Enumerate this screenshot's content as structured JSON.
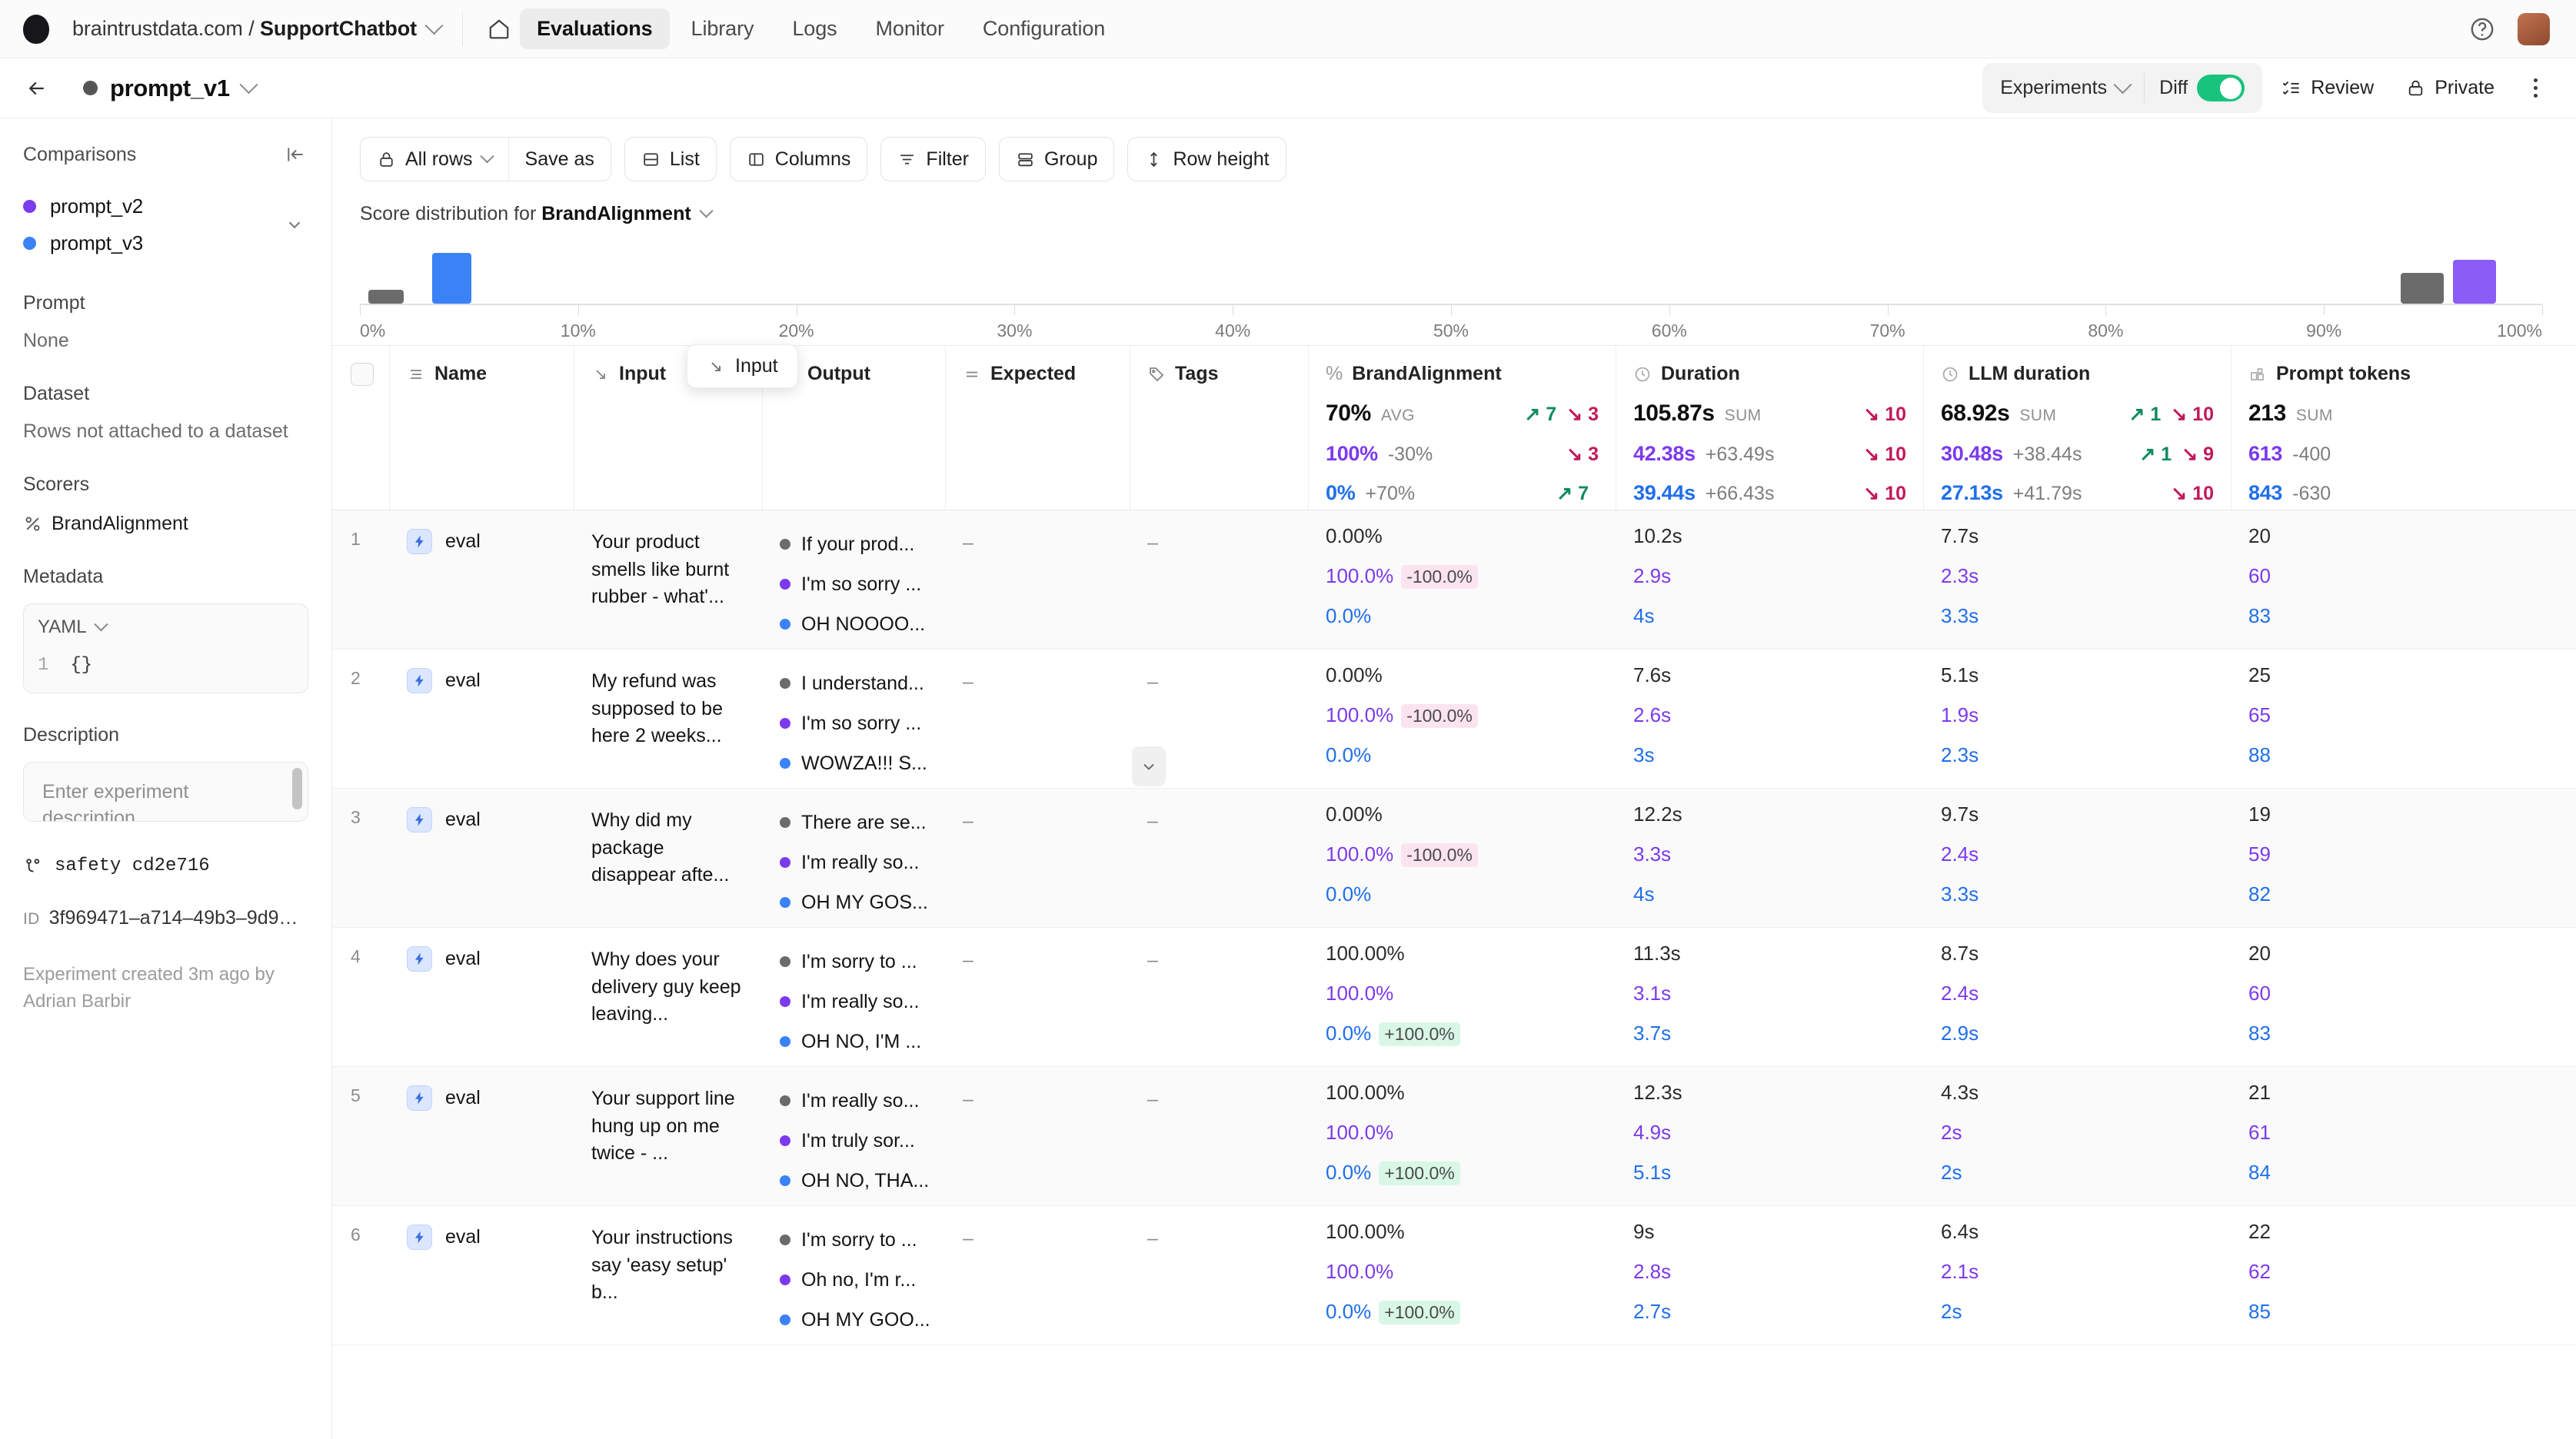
{
  "topbar": {
    "org_prefix": "braintrustdata.com / ",
    "org_project": "SupportChatbot",
    "nav": [
      {
        "label": "Evaluations",
        "active": true
      },
      {
        "label": "Library",
        "active": false
      },
      {
        "label": "Logs",
        "active": false
      },
      {
        "label": "Monitor",
        "active": false
      },
      {
        "label": "Configuration",
        "active": false
      }
    ],
    "home_icon": "home-icon",
    "help_icon": "help-circle-icon",
    "avatar": "user-avatar"
  },
  "subheader": {
    "back_icon": "back-arrow-icon",
    "experiment_name": "prompt_v1",
    "experiments_label": "Experiments",
    "diff_label": "Diff",
    "diff_on": true,
    "review_label": "Review",
    "private_label": "Private",
    "more_icon": "kebab-menu-icon"
  },
  "sidebar": {
    "comparisons_title": "Comparisons",
    "comparisons": [
      {
        "label": "prompt_v2",
        "color": "#7c3aed"
      },
      {
        "label": "prompt_v3",
        "color": "#3b82f6"
      }
    ],
    "prompt_label": "Prompt",
    "prompt_value": "None",
    "dataset_label": "Dataset",
    "dataset_value": "Rows not attached to a dataset",
    "scorers_label": "Scorers",
    "scorer_name": "BrandAlignment",
    "metadata_label": "Metadata",
    "metadata_lang": "YAML",
    "metadata_gutter": "1",
    "metadata_value": "{}",
    "description_label": "Description",
    "description_placeholder": "Enter experiment description...",
    "branch": "safety cd2e716",
    "id_tag": "ID",
    "id_value": "3f969471–a714–49b3–9d9…",
    "created": "Experiment created 3m ago by Adrian Barbir"
  },
  "toolbar": {
    "all_rows": "All rows",
    "save_as": "Save as",
    "list": "List",
    "columns": "Columns",
    "filter": "Filter",
    "group": "Group",
    "row_height": "Row height"
  },
  "distribution": {
    "title_prefix": "Score distribution for ",
    "title_metric": "BrandAlignment"
  },
  "chart_data": {
    "type": "bar",
    "title": "Score distribution for BrandAlignment",
    "xlabel": "",
    "ylabel": "",
    "xlim": [
      0,
      100
    ],
    "grid": false,
    "legend": "none",
    "tick_labels": [
      "0%",
      "10%",
      "20%",
      "30%",
      "40%",
      "50%",
      "60%",
      "70%",
      "80%",
      "90%",
      "100%"
    ],
    "ticks": [
      0,
      10,
      20,
      30,
      40,
      50,
      60,
      70,
      80,
      90,
      100
    ],
    "bars": [
      {
        "series": "prompt_v1",
        "color": "#6b6b6b",
        "x_pct": 0.4,
        "width_pct": 1.6,
        "height_pct": 22
      },
      {
        "series": "prompt_v3",
        "color": "#3b82f6",
        "x_pct": 3.3,
        "width_pct": 1.8,
        "height_pct": 78
      },
      {
        "series": "prompt_v1",
        "color": "#6b6b6b",
        "x_pct": 93.5,
        "width_pct": 2.0,
        "height_pct": 48
      },
      {
        "series": "prompt_v2",
        "color": "#8b5cf6",
        "x_pct": 95.9,
        "width_pct": 2.0,
        "height_pct": 68
      }
    ]
  },
  "table": {
    "columns": [
      {
        "key": "check",
        "label": "",
        "icon": "checkbox-icon"
      },
      {
        "key": "name",
        "label": "Name",
        "icon": "list-icon"
      },
      {
        "key": "input",
        "label": "Input",
        "icon": "arrow-into-icon"
      },
      {
        "key": "output",
        "label": "Output",
        "icon": "arrow-out-icon"
      },
      {
        "key": "expected",
        "label": "Expected",
        "icon": "equals-icon"
      },
      {
        "key": "tags",
        "label": "Tags",
        "icon": "tag-icon"
      },
      {
        "key": "brand",
        "label": "BrandAlignment",
        "icon": "percent-icon"
      },
      {
        "key": "duration",
        "label": "Duration",
        "icon": "clock-icon"
      },
      {
        "key": "llm",
        "label": "LLM duration",
        "icon": "clock-icon"
      },
      {
        "key": "tokens",
        "label": "Prompt tokens",
        "icon": "blocks-icon"
      }
    ],
    "drag_chip": {
      "label": "Input",
      "icon": "arrow-into-icon"
    },
    "summary": {
      "brand": [
        {
          "value": "70%",
          "agg": "AVG",
          "delta": "",
          "up": "↗ 7",
          "down": "↘ 3",
          "color": "#0d0d0d"
        },
        {
          "value": "100%",
          "agg": "",
          "delta": "-30%",
          "up": "",
          "down": "↘ 3",
          "color": "#7c3aed"
        },
        {
          "value": "0%",
          "agg": "",
          "delta": "+70%",
          "up": "↗ 7",
          "down": "",
          "color": "#1f6feb"
        }
      ],
      "duration": [
        {
          "value": "105.87s",
          "agg": "SUM",
          "delta": "",
          "up": "",
          "down": "↘ 10",
          "color": "#0d0d0d"
        },
        {
          "value": "42.38s",
          "agg": "",
          "delta": "+63.49s",
          "up": "",
          "down": "↘ 10",
          "color": "#7c3aed"
        },
        {
          "value": "39.44s",
          "agg": "",
          "delta": "+66.43s",
          "up": "",
          "down": "↘ 10",
          "color": "#1f6feb"
        }
      ],
      "llm": [
        {
          "value": "68.92s",
          "agg": "SUM",
          "delta": "",
          "up": "↗ 1",
          "down": "↘ 10",
          "color": "#0d0d0d"
        },
        {
          "value": "30.48s",
          "agg": "",
          "delta": "+38.44s",
          "up": "↗ 1",
          "down": "↘ 9",
          "color": "#7c3aed"
        },
        {
          "value": "27.13s",
          "agg": "",
          "delta": "+41.79s",
          "up": "",
          "down": "↘ 10",
          "color": "#1f6feb"
        }
      ],
      "tokens": [
        {
          "value": "213",
          "agg": "SUM",
          "delta": "",
          "up": "",
          "down": "",
          "color": "#0d0d0d"
        },
        {
          "value": "613",
          "agg": "",
          "delta": "-400",
          "up": "",
          "down": "",
          "color": "#7c3aed"
        },
        {
          "value": "843",
          "agg": "",
          "delta": "-630",
          "up": "",
          "down": "",
          "color": "#1f6feb"
        }
      ]
    },
    "rows": [
      {
        "index": "1",
        "name": "eval",
        "input": "Your product smells like burnt rubber - what'...",
        "outputs": [
          {
            "text": "If your prod...",
            "color": "#6b6b6b"
          },
          {
            "text": "I'm so sorry ...",
            "color": "#7c3aed"
          },
          {
            "text": "OH NOOOO...",
            "color": "#3b82f6"
          }
        ],
        "expected": "–",
        "tags": "–",
        "brand": [
          {
            "value": "0.00%",
            "delta": "",
            "delta_kind": "",
            "color": "#2b2b2b"
          },
          {
            "value": "100.0%",
            "delta": "-100.0%",
            "delta_kind": "neg",
            "color": "#7c3aed"
          },
          {
            "value": "0.0%",
            "delta": "",
            "delta_kind": "",
            "color": "#1f6feb"
          }
        ],
        "duration": [
          {
            "value": "10.2s",
            "color": "#2b2b2b"
          },
          {
            "value": "2.9s",
            "color": "#7c3aed"
          },
          {
            "value": "4s",
            "color": "#1f6feb"
          }
        ],
        "llm": [
          {
            "value": "7.7s",
            "color": "#2b2b2b"
          },
          {
            "value": "2.3s",
            "color": "#7c3aed"
          },
          {
            "value": "3.3s",
            "color": "#1f6feb"
          }
        ],
        "tokens": [
          {
            "value": "20",
            "color": "#2b2b2b"
          },
          {
            "value": "60",
            "color": "#7c3aed"
          },
          {
            "value": "83",
            "color": "#1f6feb"
          }
        ]
      },
      {
        "index": "2",
        "name": "eval",
        "input": "My refund was supposed to be here 2 weeks...",
        "outputs": [
          {
            "text": "I understand...",
            "color": "#6b6b6b"
          },
          {
            "text": "I'm so sorry ...",
            "color": "#7c3aed"
          },
          {
            "text": "WOWZA!!! S...",
            "color": "#3b82f6"
          }
        ],
        "expected": "–",
        "tags": "–",
        "brand": [
          {
            "value": "0.00%",
            "delta": "",
            "delta_kind": "",
            "color": "#2b2b2b"
          },
          {
            "value": "100.0%",
            "delta": "-100.0%",
            "delta_kind": "neg",
            "color": "#7c3aed"
          },
          {
            "value": "0.0%",
            "delta": "",
            "delta_kind": "",
            "color": "#1f6feb"
          }
        ],
        "duration": [
          {
            "value": "7.6s",
            "color": "#2b2b2b"
          },
          {
            "value": "2.6s",
            "color": "#7c3aed"
          },
          {
            "value": "3s",
            "color": "#1f6feb"
          }
        ],
        "llm": [
          {
            "value": "5.1s",
            "color": "#2b2b2b"
          },
          {
            "value": "1.9s",
            "color": "#7c3aed"
          },
          {
            "value": "2.3s",
            "color": "#1f6feb"
          }
        ],
        "tokens": [
          {
            "value": "25",
            "color": "#2b2b2b"
          },
          {
            "value": "65",
            "color": "#7c3aed"
          },
          {
            "value": "88",
            "color": "#1f6feb"
          }
        ]
      },
      {
        "index": "3",
        "name": "eval",
        "input": "Why did my package disappear afte...",
        "outputs": [
          {
            "text": "There are se...",
            "color": "#6b6b6b"
          },
          {
            "text": "I'm really so...",
            "color": "#7c3aed"
          },
          {
            "text": "OH MY GOS...",
            "color": "#3b82f6"
          }
        ],
        "expected": "–",
        "tags": "–",
        "brand": [
          {
            "value": "0.00%",
            "delta": "",
            "delta_kind": "",
            "color": "#2b2b2b"
          },
          {
            "value": "100.0%",
            "delta": "-100.0%",
            "delta_kind": "neg",
            "color": "#7c3aed"
          },
          {
            "value": "0.0%",
            "delta": "",
            "delta_kind": "",
            "color": "#1f6feb"
          }
        ],
        "duration": [
          {
            "value": "12.2s",
            "color": "#2b2b2b"
          },
          {
            "value": "3.3s",
            "color": "#7c3aed"
          },
          {
            "value": "4s",
            "color": "#1f6feb"
          }
        ],
        "llm": [
          {
            "value": "9.7s",
            "color": "#2b2b2b"
          },
          {
            "value": "2.4s",
            "color": "#7c3aed"
          },
          {
            "value": "3.3s",
            "color": "#1f6feb"
          }
        ],
        "tokens": [
          {
            "value": "19",
            "color": "#2b2b2b"
          },
          {
            "value": "59",
            "color": "#7c3aed"
          },
          {
            "value": "82",
            "color": "#1f6feb"
          }
        ]
      },
      {
        "index": "4",
        "name": "eval",
        "input": "Why does your delivery guy keep leaving...",
        "outputs": [
          {
            "text": "I'm sorry to ...",
            "color": "#6b6b6b"
          },
          {
            "text": "I'm really so...",
            "color": "#7c3aed"
          },
          {
            "text": "OH NO, I'M ...",
            "color": "#3b82f6"
          }
        ],
        "expected": "–",
        "tags": "–",
        "brand": [
          {
            "value": "100.00%",
            "delta": "",
            "delta_kind": "",
            "color": "#2b2b2b"
          },
          {
            "value": "100.0%",
            "delta": "",
            "delta_kind": "",
            "color": "#7c3aed"
          },
          {
            "value": "0.0%",
            "delta": "+100.0%",
            "delta_kind": "pos",
            "color": "#1f6feb"
          }
        ],
        "duration": [
          {
            "value": "11.3s",
            "color": "#2b2b2b"
          },
          {
            "value": "3.1s",
            "color": "#7c3aed"
          },
          {
            "value": "3.7s",
            "color": "#1f6feb"
          }
        ],
        "llm": [
          {
            "value": "8.7s",
            "color": "#2b2b2b"
          },
          {
            "value": "2.4s",
            "color": "#7c3aed"
          },
          {
            "value": "2.9s",
            "color": "#1f6feb"
          }
        ],
        "tokens": [
          {
            "value": "20",
            "color": "#2b2b2b"
          },
          {
            "value": "60",
            "color": "#7c3aed"
          },
          {
            "value": "83",
            "color": "#1f6feb"
          }
        ]
      },
      {
        "index": "5",
        "name": "eval",
        "input": "Your support line hung up on me twice - ...",
        "outputs": [
          {
            "text": "I'm really so...",
            "color": "#6b6b6b"
          },
          {
            "text": "I'm truly sor...",
            "color": "#7c3aed"
          },
          {
            "text": "OH NO, THA...",
            "color": "#3b82f6"
          }
        ],
        "expected": "–",
        "tags": "–",
        "brand": [
          {
            "value": "100.00%",
            "delta": "",
            "delta_kind": "",
            "color": "#2b2b2b"
          },
          {
            "value": "100.0%",
            "delta": "",
            "delta_kind": "",
            "color": "#7c3aed"
          },
          {
            "value": "0.0%",
            "delta": "+100.0%",
            "delta_kind": "pos",
            "color": "#1f6feb"
          }
        ],
        "duration": [
          {
            "value": "12.3s",
            "color": "#2b2b2b"
          },
          {
            "value": "4.9s",
            "color": "#7c3aed"
          },
          {
            "value": "5.1s",
            "color": "#1f6feb"
          }
        ],
        "llm": [
          {
            "value": "4.3s",
            "color": "#2b2b2b"
          },
          {
            "value": "2s",
            "color": "#7c3aed"
          },
          {
            "value": "2s",
            "color": "#1f6feb"
          }
        ],
        "tokens": [
          {
            "value": "21",
            "color": "#2b2b2b"
          },
          {
            "value": "61",
            "color": "#7c3aed"
          },
          {
            "value": "84",
            "color": "#1f6feb"
          }
        ]
      },
      {
        "index": "6",
        "name": "eval",
        "input": "Your instructions say 'easy setup' b...",
        "outputs": [
          {
            "text": "I'm sorry to ...",
            "color": "#6b6b6b"
          },
          {
            "text": "Oh no, I'm r...",
            "color": "#7c3aed"
          },
          {
            "text": "OH MY GOO...",
            "color": "#3b82f6"
          }
        ],
        "expected": "–",
        "tags": "–",
        "brand": [
          {
            "value": "100.00%",
            "delta": "",
            "delta_kind": "",
            "color": "#2b2b2b"
          },
          {
            "value": "100.0%",
            "delta": "",
            "delta_kind": "",
            "color": "#7c3aed"
          },
          {
            "value": "0.0%",
            "delta": "+100.0%",
            "delta_kind": "pos",
            "color": "#1f6feb"
          }
        ],
        "duration": [
          {
            "value": "9s",
            "color": "#2b2b2b"
          },
          {
            "value": "2.8s",
            "color": "#7c3aed"
          },
          {
            "value": "2.7s",
            "color": "#1f6feb"
          }
        ],
        "llm": [
          {
            "value": "6.4s",
            "color": "#2b2b2b"
          },
          {
            "value": "2.1s",
            "color": "#7c3aed"
          },
          {
            "value": "2s",
            "color": "#1f6feb"
          }
        ],
        "tokens": [
          {
            "value": "22",
            "color": "#2b2b2b"
          },
          {
            "value": "62",
            "color": "#7c3aed"
          },
          {
            "value": "85",
            "color": "#1f6feb"
          }
        ]
      }
    ]
  }
}
